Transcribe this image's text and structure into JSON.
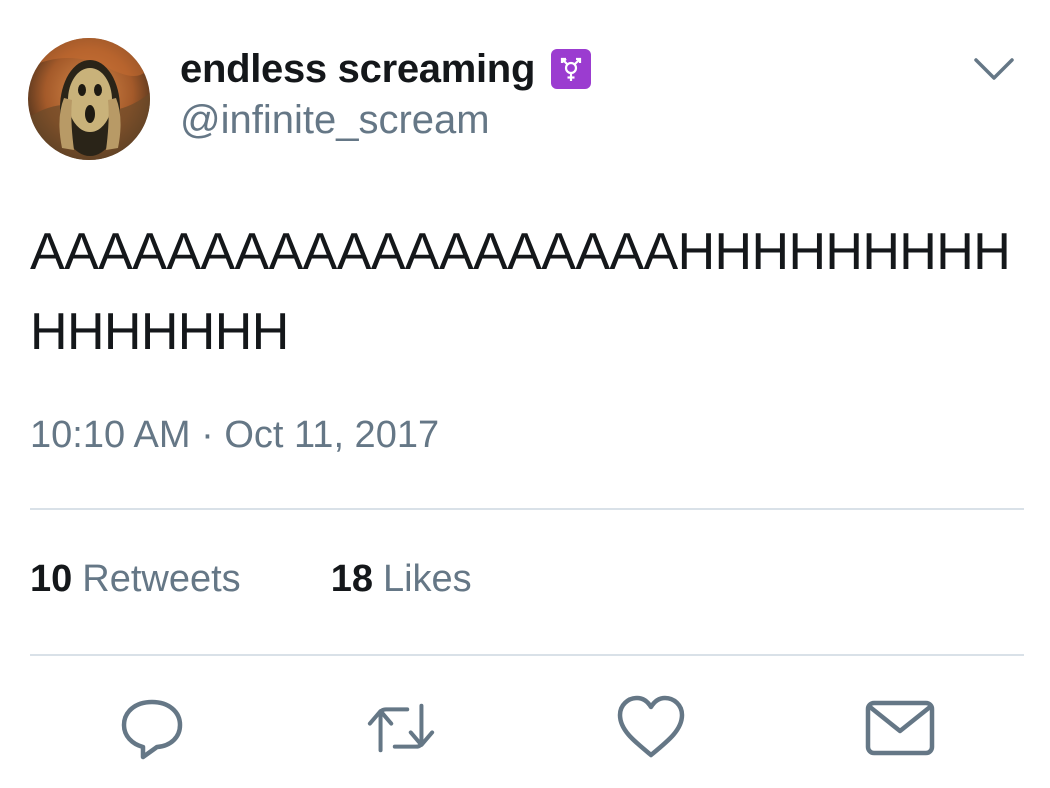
{
  "user": {
    "display_name": "endless screaming",
    "handle": "@infinite_scream",
    "name_badge_icon": "transgender-symbol-icon"
  },
  "tweet": {
    "text": "AAAAAAAAAAAAAAAAAAAHHHHHHHHHHHHHHHH",
    "timestamp": "10:10 AM · Oct 11, 2017"
  },
  "stats": {
    "retweets": {
      "count": "10",
      "label": "Retweets"
    },
    "likes": {
      "count": "18",
      "label": "Likes"
    }
  },
  "actions": {
    "reply": "reply-icon",
    "retweet": "retweet-icon",
    "like": "heart-icon",
    "message": "envelope-icon"
  },
  "colors": {
    "primary_text": "#14171a",
    "secondary_text": "#657786",
    "divider": "#d9e1e8",
    "badge": "#9b3cd0"
  }
}
